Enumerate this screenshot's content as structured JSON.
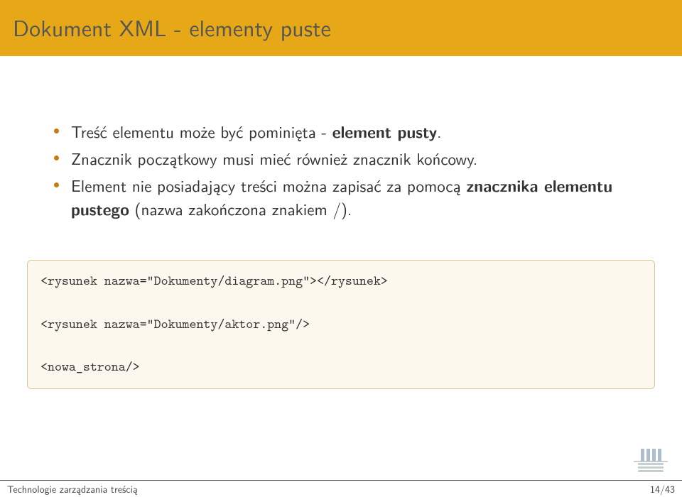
{
  "title": "Dokument XML - elementy puste",
  "bullets": [
    {
      "pre": "Treść elementu może być pominięta - ",
      "bold": "element pusty",
      "post": "."
    },
    {
      "text": "Znacznik początkowy musi mieć również znacznik końcowy."
    },
    {
      "pre": "Element nie posiadający treści można zapisać za pomocą ",
      "bold": "znacznika elementu pustego",
      "post": " (nazwa zakończona znakiem /)."
    }
  ],
  "code": [
    "<rysunek nazwa=\"Dokumenty/diagram.png\"></rysunek>",
    "<rysunek nazwa=\"Dokumenty/aktor.png\"/>",
    "<nowa_strona/>"
  ],
  "footer": {
    "left": "Technologie zarządzania treścią",
    "right": "14/43"
  }
}
